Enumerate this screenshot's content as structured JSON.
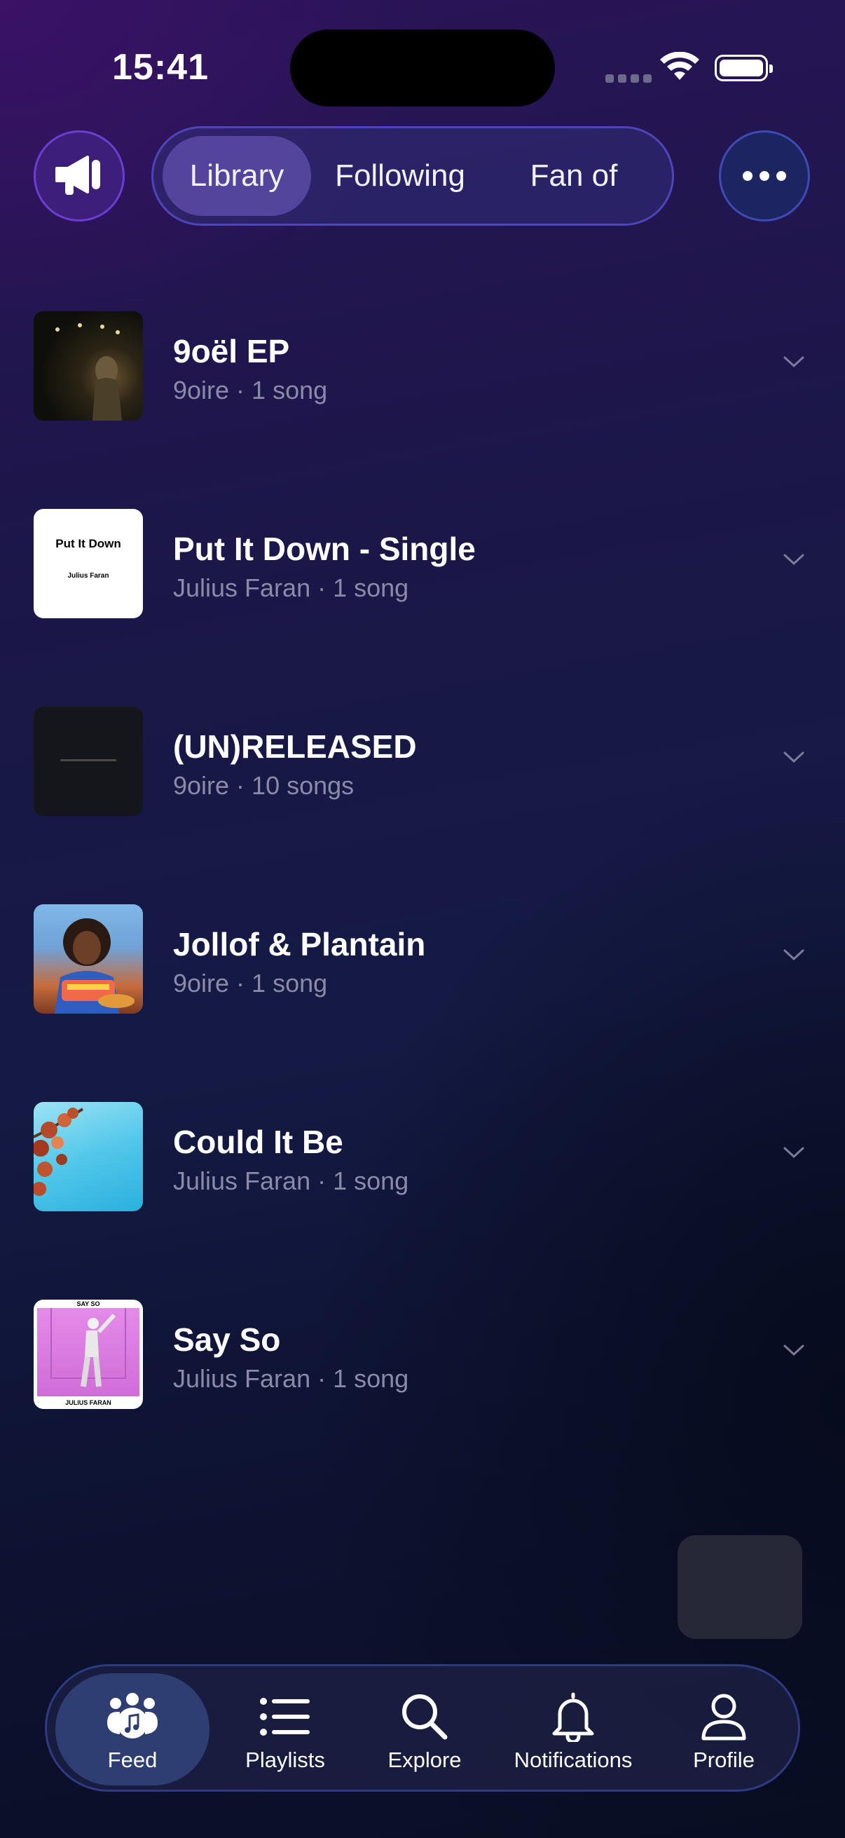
{
  "status_bar": {
    "time": "15:41"
  },
  "header": {
    "segments": [
      {
        "label": "Library",
        "active": true
      },
      {
        "label": "Following",
        "active": false
      },
      {
        "label": "Fan of",
        "active": false
      }
    ]
  },
  "library": {
    "items": [
      {
        "title": "9oël EP",
        "subtitle": "9oire · 1 song",
        "art_color": "#1e1a10"
      },
      {
        "title": "Put It Down - Single",
        "subtitle": "Julius Faran · 1 song",
        "art_text": "Put It Down",
        "art_artist": "Julius Faran",
        "art_color": "#ffffff"
      },
      {
        "title": "(UN)RELEASED",
        "subtitle": "9oire · 10 songs",
        "art_color": "#121419"
      },
      {
        "title": "Jollof & Plantain",
        "subtitle": "9oire · 1 song",
        "art_color": "#4f88c7"
      },
      {
        "title": "Could It Be",
        "subtitle": "Julius Faran · 1 song",
        "art_color": "#4ec6e6"
      },
      {
        "title": "Say So",
        "subtitle": "Julius Faran · 1 song",
        "art_top": "SAY SO",
        "art_bottom": "JULIUS FARAN",
        "art_color": "#d77be0"
      }
    ]
  },
  "tabbar": {
    "tabs": [
      {
        "label": "Feed",
        "icon": "feed-music-people-icon",
        "active": true
      },
      {
        "label": "Playlists",
        "icon": "list-icon",
        "active": false
      },
      {
        "label": "Explore",
        "icon": "search-icon",
        "active": false
      },
      {
        "label": "Notifications",
        "icon": "bell-icon",
        "active": false
      },
      {
        "label": "Profile",
        "icon": "person-icon",
        "active": false
      }
    ]
  }
}
